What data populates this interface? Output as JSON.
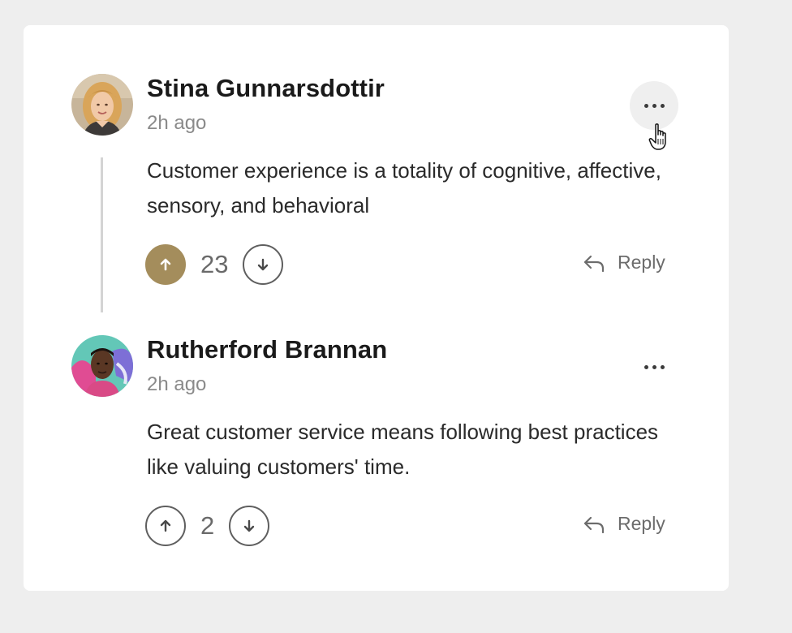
{
  "comments": [
    {
      "author": "Stina Gunnarsdottir",
      "time": "2h ago",
      "text": "Customer experience is a totality of cognitive, affective, sensory, and behavioral",
      "votes": "23",
      "upvoted": true,
      "reply_label": "Reply",
      "menu_hovered": true,
      "avatar_icon": "avatar-blonde-woman"
    },
    {
      "author": "Rutherford Brannan",
      "time": "2h ago",
      "text": "Great customer service means following best practices like valuing customers' time.",
      "votes": "2",
      "upvoted": false,
      "reply_label": "Reply",
      "menu_hovered": false,
      "avatar_icon": "avatar-man-colorful-background"
    }
  ],
  "colors": {
    "upvote_active": "#a48d5c",
    "page_background": "#eeeeee",
    "card_background": "#ffffff"
  },
  "icons": [
    "more-horizontal-icon",
    "arrow-up-icon",
    "arrow-down-icon",
    "reply-arrow-icon",
    "hand-cursor-icon"
  ]
}
